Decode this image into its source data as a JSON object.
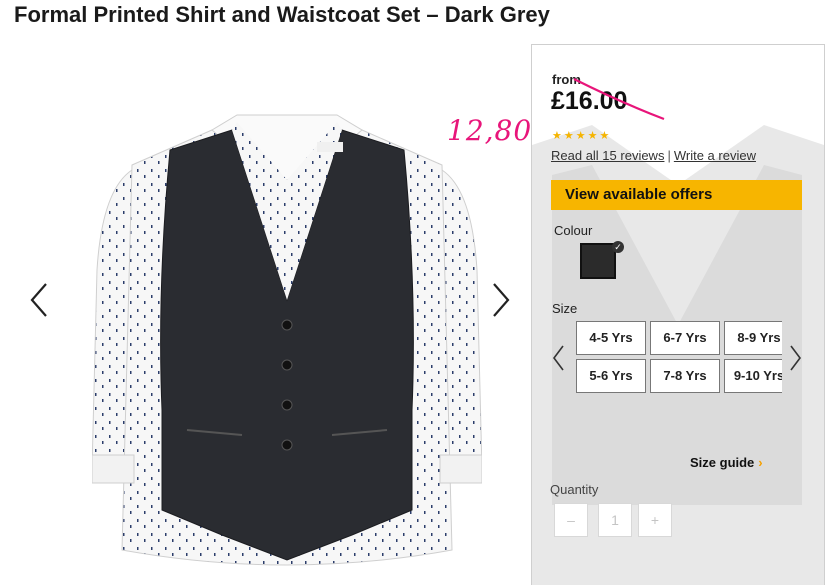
{
  "product": {
    "title": "Formal Printed Shirt and Waistcoat Set – Dark Grey"
  },
  "gallery": {
    "prev_icon": "chevron-left-icon",
    "next_icon": "chevron-right-icon"
  },
  "pricing": {
    "from_label": "from",
    "price": "£16.00",
    "handwritten_price": "12,80",
    "handwritten_color": "#e8157a"
  },
  "rating": {
    "stars": "★★★★★",
    "star_count": 5,
    "read_reviews": "Read all 15 reviews",
    "separator": "|",
    "write_review": "Write a review"
  },
  "offers": {
    "label": "View available offers",
    "color": "#f7b500"
  },
  "colour": {
    "label": "Colour",
    "selected_swatch": "#2b2b2b",
    "check_icon": "check-icon",
    "check_glyph": "✓"
  },
  "size": {
    "label": "Size",
    "options": [
      "4-5 Yrs",
      "6-7 Yrs",
      "8-9 Yrs",
      "5-6 Yrs",
      "7-8 Yrs",
      "9-10 Yrs"
    ],
    "guide": "Size guide",
    "guide_chevron": "›"
  },
  "quantity": {
    "label": "Quantity",
    "minus": "–",
    "value": "1",
    "plus": "+"
  }
}
